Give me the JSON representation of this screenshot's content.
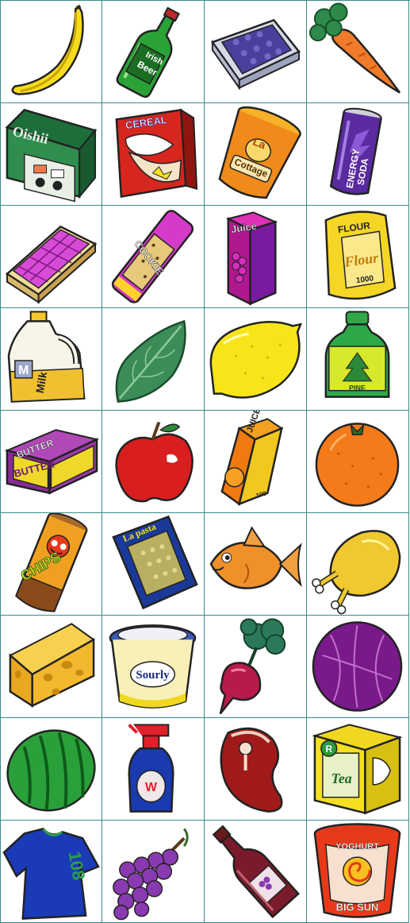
{
  "sprite_sheet": {
    "columns": 4,
    "rows": 9,
    "grid_color": "#3d8a8a",
    "items": [
      {
        "name": "banana"
      },
      {
        "name": "beer-bottle",
        "labels": [
          "Irish",
          "Beer"
        ]
      },
      {
        "name": "blueberries-tray"
      },
      {
        "name": "carrot"
      },
      {
        "name": "sushi-box",
        "labels": [
          "Oishii"
        ]
      },
      {
        "name": "cereal-box",
        "labels": [
          "CEREAL"
        ]
      },
      {
        "name": "cottage-cheese-tub",
        "labels": [
          "La",
          "Cottage"
        ]
      },
      {
        "name": "energy-soda-can",
        "labels": [
          "ENERGY",
          "SODA"
        ]
      },
      {
        "name": "waffle"
      },
      {
        "name": "cookies-pack",
        "labels": [
          "COOKIE"
        ]
      },
      {
        "name": "grape-juice-carton",
        "labels": [
          "Juice"
        ]
      },
      {
        "name": "flour-bag",
        "labels": [
          "FLOUR",
          "Flour",
          "1000"
        ]
      },
      {
        "name": "milk-jug",
        "labels": [
          "M",
          "Milk"
        ]
      },
      {
        "name": "spinach-leaf"
      },
      {
        "name": "lemon"
      },
      {
        "name": "pine-bottle",
        "labels": [
          "PINE"
        ]
      },
      {
        "name": "butter-package",
        "labels": [
          "BUTTER",
          "BUTTER"
        ]
      },
      {
        "name": "apple"
      },
      {
        "name": "orange-juice-carton",
        "labels": [
          "JUICE",
          "100"
        ]
      },
      {
        "name": "orange"
      },
      {
        "name": "chips-can",
        "labels": [
          "CHIPS"
        ]
      },
      {
        "name": "pasta-bag",
        "labels": [
          "La pasta"
        ]
      },
      {
        "name": "goldfish"
      },
      {
        "name": "roast-chicken"
      },
      {
        "name": "cheese-wedge"
      },
      {
        "name": "sour-cream-tub",
        "labels": [
          "Sourly"
        ]
      },
      {
        "name": "beet"
      },
      {
        "name": "red-cabbage"
      },
      {
        "name": "watermelon"
      },
      {
        "name": "spray-cleaner",
        "labels": [
          "W"
        ]
      },
      {
        "name": "steak"
      },
      {
        "name": "tea-box",
        "labels": [
          "R",
          "Tea"
        ]
      },
      {
        "name": "t-shirt",
        "labels": [
          "108"
        ]
      },
      {
        "name": "grapes"
      },
      {
        "name": "wine-bottle"
      },
      {
        "name": "yoghurt-cup",
        "labels": [
          "YOGHURT",
          "BIG SUN"
        ]
      }
    ]
  }
}
